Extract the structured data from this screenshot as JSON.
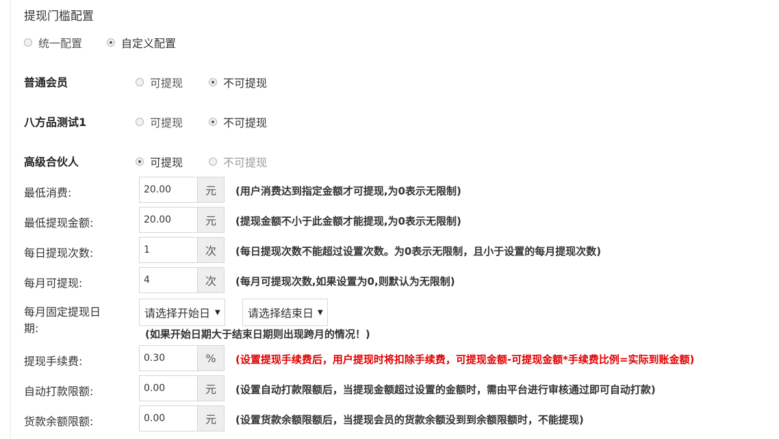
{
  "section_title": "提现门槛配置",
  "config_mode": {
    "options": [
      "统一配置",
      "自定义配置"
    ],
    "selected": "自定义配置"
  },
  "withdraw_options": [
    "可提现",
    "不可提现"
  ],
  "members": [
    {
      "name": "普通会员",
      "selected": "不可提现"
    },
    {
      "name": "八方品测试1",
      "selected": "不可提现"
    },
    {
      "name": "高级合伙人",
      "selected": "可提现"
    }
  ],
  "fields": {
    "min_consume": {
      "label": "最低消费:",
      "value": "20.00",
      "unit": "元",
      "hint": "(用户消费达到指定金额才可提现,为0表示无限制)"
    },
    "min_withdraw": {
      "label": "最低提现金额:",
      "value": "20.00",
      "unit": "元",
      "hint": "(提现金额不小于此金额才能提现,为0表示无限制)"
    },
    "daily_count": {
      "label": "每日提现次数:",
      "value": "1",
      "unit": "次",
      "hint": "(每日提现次数不能超过设置次数。为0表示无限制，且小于设置的每月提现次数)"
    },
    "monthly_count": {
      "label": "每月可提现:",
      "value": "4",
      "unit": "次",
      "hint": "(每月可提现次数,如果设置为0,则默认为无限制)"
    },
    "fixed_date": {
      "label_line1": "每月固定提现日",
      "label_line2": "期:",
      "start_placeholder": "请选择开始日",
      "end_placeholder": "请选择结束日",
      "hint": "(如果开始日期大于结束日期则出现跨月的情况！)"
    },
    "fee": {
      "label": "提现手续费:",
      "value": "0.30",
      "unit": "%",
      "hint": "(设置提现手续费后，用户提现时将扣除手续费，可提现金额-可提现金额*手续费比例=实际到账金额)"
    },
    "auto_pay_limit": {
      "label": "自动打款限额:",
      "value": "0.00",
      "unit": "元",
      "hint": "(设置自动打款限额后，当提现金额超过设置的金额时，需由平台进行审核通过即可自动打款)"
    },
    "goods_balance_limit": {
      "label": "货款余额限额:",
      "value": "0.00",
      "unit": "元",
      "hint": "(设置货款余额限额后，当提现会员的货款余额没到到余额限额时，不能提现)"
    }
  },
  "colors": {
    "warning_hint": "#e10000",
    "addon_bg": "#eeeeee",
    "border": "#d6d6d6"
  }
}
